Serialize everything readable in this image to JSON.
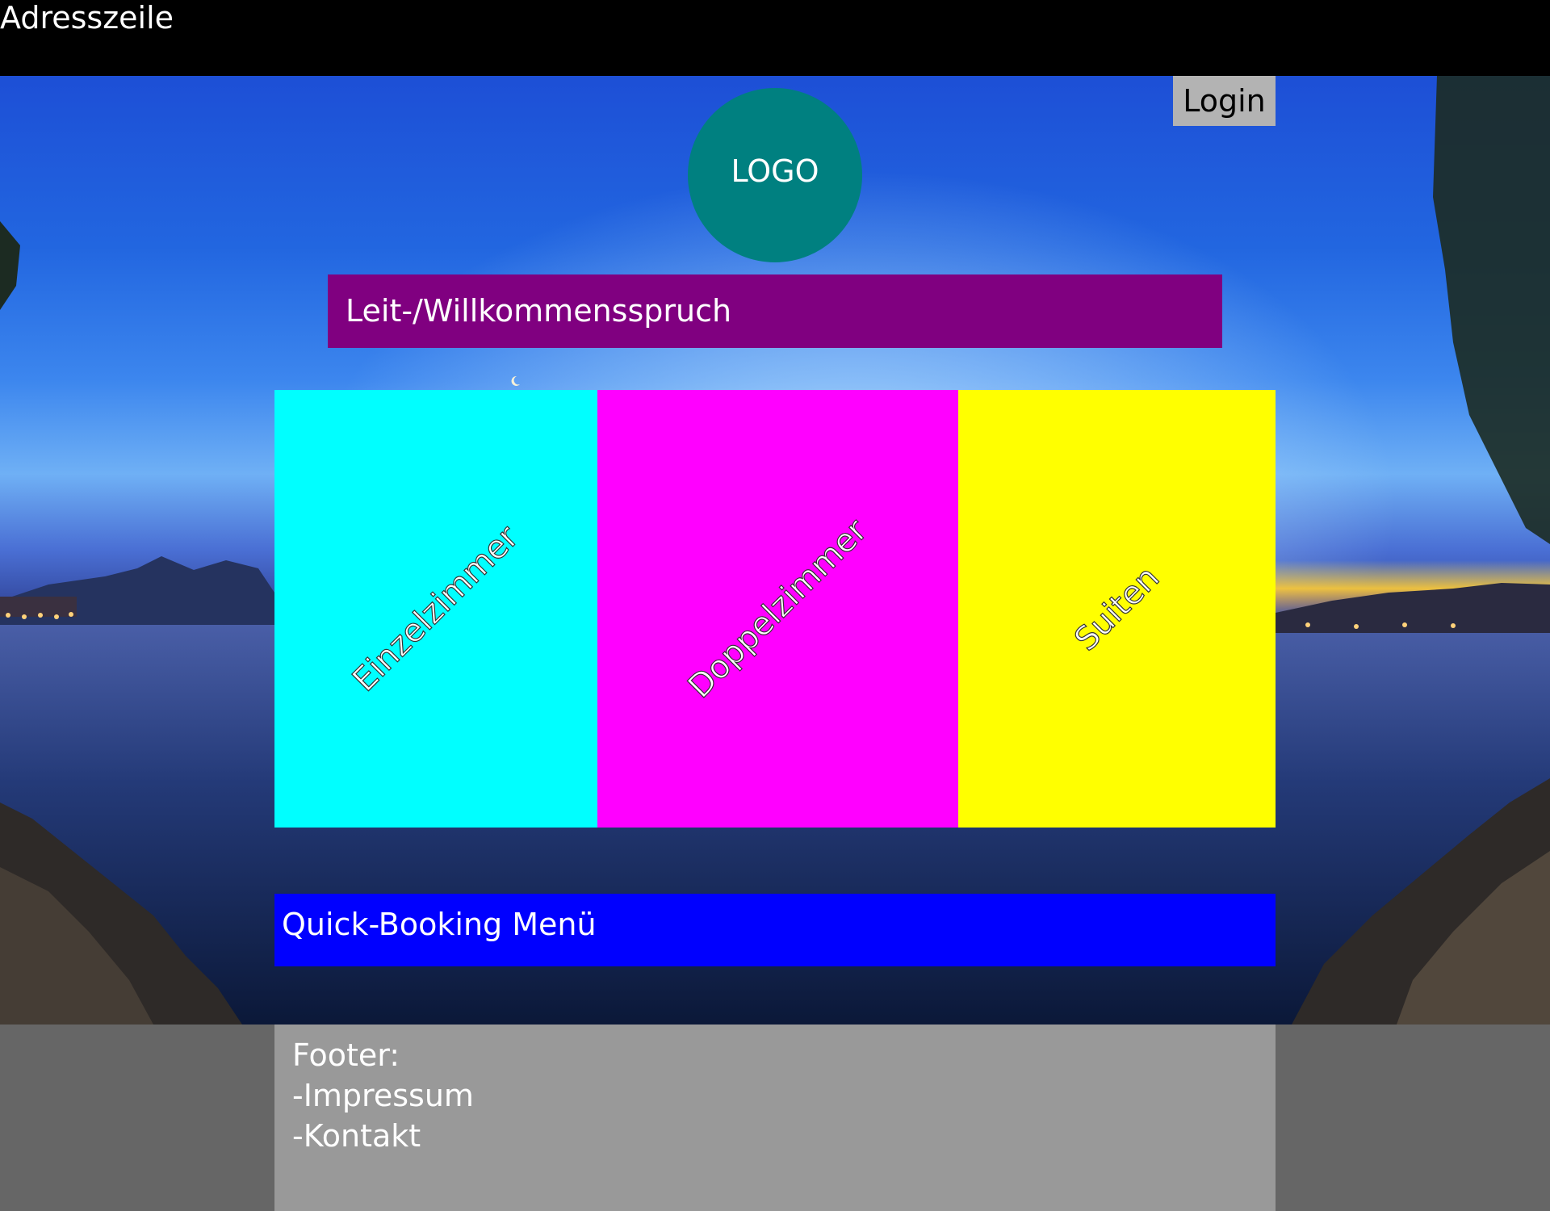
{
  "address_bar": {
    "text": "Adresszeile"
  },
  "header": {
    "login_label": "Login",
    "logo_text": "LOGO"
  },
  "slogan": {
    "text": "Leit-/Willkommensspruch"
  },
  "rooms": [
    {
      "label": "Einzelzimmer",
      "color": "#00ffff"
    },
    {
      "label": "Doppelzimmer",
      "color": "#ff00ff"
    },
    {
      "label": "Suiten",
      "color": "#ffff00"
    }
  ],
  "quick_booking": {
    "label": "Quick-Booking Menü",
    "color": "#0000ff"
  },
  "footer": {
    "title": "Footer:",
    "links": [
      "-Impressum",
      "-Kontakt"
    ]
  },
  "colors": {
    "logo": "#008080",
    "slogan": "#800080",
    "login": "#b3b3b3",
    "footer": "#999999",
    "footer_band": "#666666"
  },
  "background": {
    "icon": "lake-sunset-photo"
  }
}
